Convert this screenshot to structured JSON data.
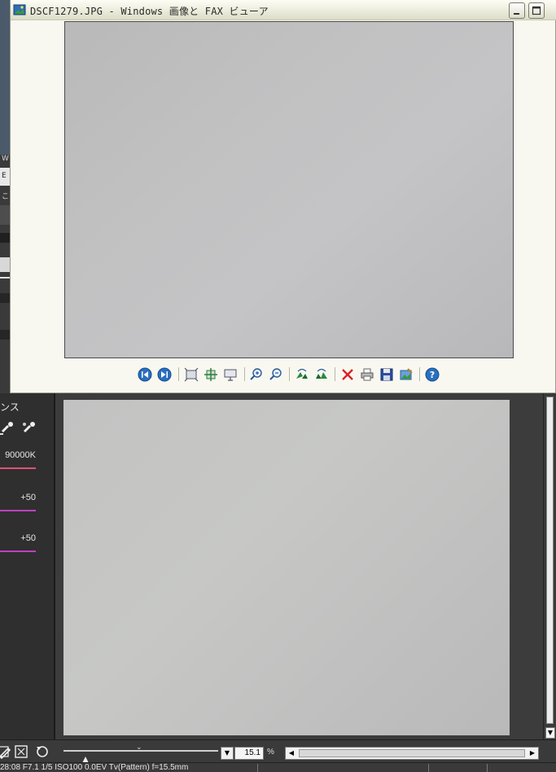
{
  "window": {
    "title": "DSCF1279.JPG - Windows 画像と FAX ビューア",
    "minimize_icon": "minimize-icon",
    "maximize_icon": "maximize-icon"
  },
  "viewer_toolbar": {
    "buttons": [
      {
        "name": "previous-image-button",
        "icon": "prev-icon"
      },
      {
        "name": "next-image-button",
        "icon": "next-icon"
      },
      {
        "name": "best-fit-button",
        "icon": "best-fit-icon"
      },
      {
        "name": "actual-size-button",
        "icon": "actual-size-icon"
      },
      {
        "name": "slideshow-button",
        "icon": "slideshow-icon"
      },
      {
        "name": "zoom-in-button",
        "icon": "zoom-in-icon"
      },
      {
        "name": "zoom-out-button",
        "icon": "zoom-out-icon"
      },
      {
        "name": "rotate-clockwise-button",
        "icon": "rotate-cw-icon"
      },
      {
        "name": "rotate-counterclockwise-button",
        "icon": "rotate-ccw-icon"
      },
      {
        "name": "delete-button",
        "icon": "delete-icon"
      },
      {
        "name": "print-button",
        "icon": "print-icon"
      },
      {
        "name": "copy-to-button",
        "icon": "save-icon"
      },
      {
        "name": "open-editor-button",
        "icon": "edit-image-icon"
      },
      {
        "name": "help-button",
        "icon": "help-icon"
      }
    ]
  },
  "background_app": {
    "left_strip_labels": [
      "W",
      "E",
      "こ"
    ],
    "panel": {
      "title": "ンス",
      "color_temperature": "90000K",
      "tint_1": "+50",
      "tint_2": "+50",
      "colors": {
        "temperature_line": "#e0507a",
        "tint_line": "#c040c0"
      }
    },
    "zoom": {
      "value": "15.1",
      "unit": "%",
      "slider_position": 0.14
    },
    "status": "28:08  F7.1  1/5  ISO100  0.0EV  Tv(Pattern)  f=15.5mm"
  }
}
